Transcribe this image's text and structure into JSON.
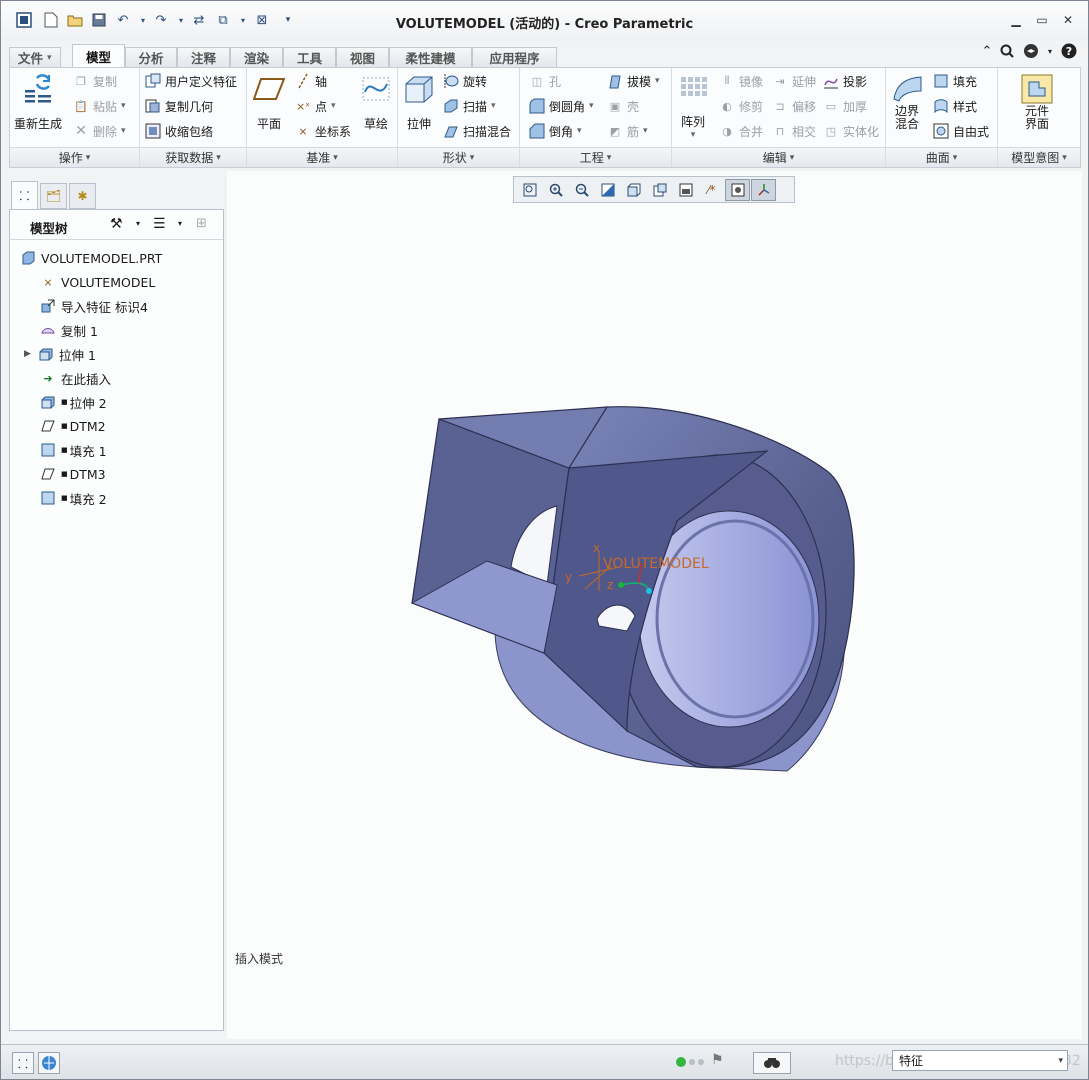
{
  "window": {
    "title": "VOLUTEMODEL (活动的) - Creo Parametric"
  },
  "tabs": [
    "文件",
    "模型",
    "分析",
    "注释",
    "渲染",
    "工具",
    "视图",
    "柔性建模",
    "应用程序"
  ],
  "ribbon": {
    "operations": {
      "label": "操作",
      "regenerate": "重新生成",
      "copy": "复制",
      "paste": "粘贴",
      "delete": "删除"
    },
    "get_data": {
      "label": "获取数据",
      "udf": "用户定义特征",
      "copy_geom": "复制几何",
      "shrinkwrap": "收缩包络"
    },
    "datum": {
      "label": "基准",
      "plane": "平面",
      "axis": "轴",
      "point": "点",
      "csys": "坐标系",
      "sketch": "草绘"
    },
    "shapes": {
      "label": "形状",
      "extrude": "拉伸",
      "revolve": "旋转",
      "sweep": "扫描",
      "swept_blend": "扫描混合"
    },
    "engineering": {
      "label": "工程",
      "hole": "孔",
      "round": "倒圆角",
      "chamfer": "倒角",
      "draft": "拔模",
      "shell": "壳",
      "rib": "筋"
    },
    "editing": {
      "label": "编辑",
      "pattern": "阵列",
      "mirror": "镜像",
      "trim": "修剪",
      "merge": "合并",
      "extend": "延伸",
      "offset": "偏移",
      "intersect": "相交",
      "project": "投影",
      "thicken": "加厚",
      "solidify": "实体化"
    },
    "surfaces": {
      "label": "曲面",
      "boundary_blend_line1": "边界",
      "boundary_blend_line2": "混合",
      "fill": "填充",
      "style": "样式",
      "freestyle": "自由式"
    },
    "model_intent": {
      "label": "模型意图",
      "component_interface_line1": "元件",
      "component_interface_line2": "界面"
    }
  },
  "model_tree": {
    "title": "模型树",
    "items": [
      {
        "label": "VOLUTEMODEL.PRT",
        "icon": "part-icon"
      },
      {
        "label": "VOLUTEMODEL",
        "icon": "csys-icon"
      },
      {
        "label": "导入特征 标识4",
        "icon": "import-icon"
      },
      {
        "label": "复制 1",
        "icon": "copy-feature-icon"
      },
      {
        "label": "拉伸 1",
        "icon": "extrude-icon"
      },
      {
        "label": "在此插入",
        "icon": "insert-here-arrow-icon"
      },
      {
        "label": "拉伸 2",
        "icon": "extrude-icon"
      },
      {
        "label": "DTM2",
        "icon": "datum-plane-icon"
      },
      {
        "label": "填充 1",
        "icon": "fill-icon"
      },
      {
        "label": "DTM3",
        "icon": "datum-plane-icon"
      },
      {
        "label": "填充 2",
        "icon": "fill-icon"
      }
    ]
  },
  "graphics": {
    "csys_label": "VOLUTEMODEL",
    "axis_x": "x",
    "axis_y": "y",
    "axis_z": "z",
    "insert_mode": "插入模式"
  },
  "status_bar": {
    "filter_value": "特征",
    "watermark": "https://blog.csdn.net/qq_41328332"
  }
}
